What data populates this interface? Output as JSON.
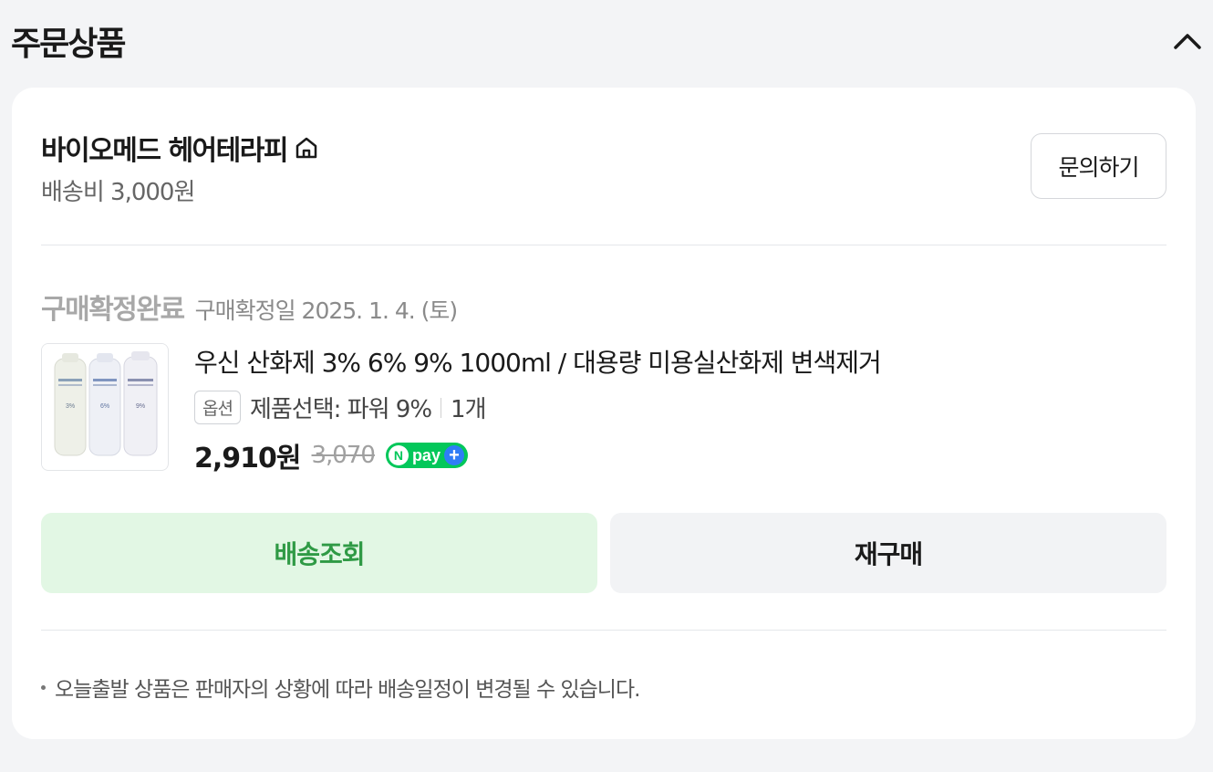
{
  "section": {
    "title": "주문상품"
  },
  "seller": {
    "name": "바이오메드 헤어테라피",
    "shipping_fee": "배송비 3,000원",
    "inquiry_label": "문의하기"
  },
  "order": {
    "status": "구매확정완료",
    "status_date": "구매확정일 2025. 1. 4. (토)"
  },
  "product": {
    "name": "우신 산화제 3% 6% 9% 1000ml / 대용량 미용실산화제 변색제거",
    "option_badge": "옵션",
    "option_text": "제품선택: 파워 9%",
    "quantity": "1개",
    "price": "2,910원",
    "original_price": "3,070",
    "npay": {
      "n": "N",
      "text": "pay",
      "plus": "+"
    },
    "bottle_labels": [
      "3%",
      "6%",
      "9%"
    ]
  },
  "actions": {
    "track_label": "배송조회",
    "rebuy_label": "재구매"
  },
  "notice": "오늘출발 상품은 판매자의 상황에 따라 배송일정이 변경될 수 있습니다.",
  "colors": {
    "track_bg": "#e2f7e4",
    "track_text": "#2f9a45",
    "npay_green": "#03c75a",
    "npay_blue": "#2f7df6"
  }
}
